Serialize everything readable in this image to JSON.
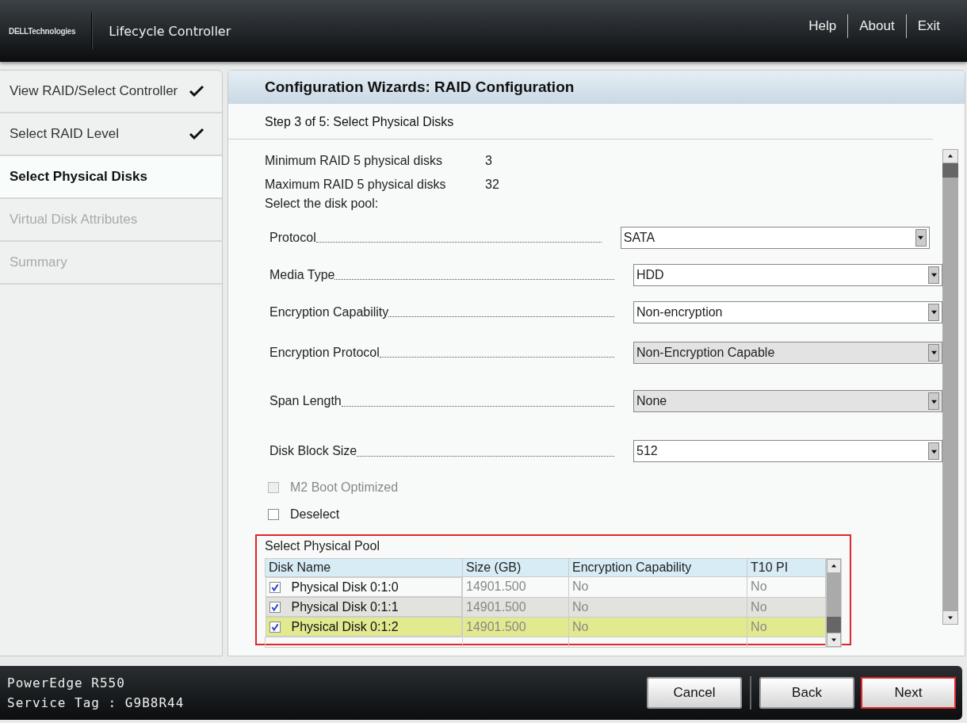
{
  "header": {
    "brand": "DELLTechnologies",
    "title": "Lifecycle Controller",
    "links": [
      "Help",
      "About",
      "Exit"
    ]
  },
  "steps": [
    {
      "label": "View RAID/Select Controller",
      "done": true,
      "selected": false,
      "disabled": false
    },
    {
      "label": "Select RAID Level",
      "done": true,
      "selected": false,
      "disabled": false
    },
    {
      "label": "Select Physical Disks",
      "done": false,
      "selected": true,
      "disabled": false
    },
    {
      "label": "Virtual Disk Attributes",
      "done": false,
      "selected": false,
      "disabled": true
    },
    {
      "label": "Summary",
      "done": false,
      "selected": false,
      "disabled": true
    }
  ],
  "panel": {
    "title": "Configuration Wizards: RAID Configuration",
    "step": "Step 3 of 5: Select Physical Disks",
    "info": [
      {
        "label": "Minimum RAID 5 physical disks",
        "value": "3"
      },
      {
        "label": "Maximum RAID 5 physical disks",
        "value": "32"
      }
    ],
    "pool_prompt": "Select the disk pool:",
    "fields": [
      {
        "label": "Protocol",
        "value": "SATA",
        "disabled": false
      },
      {
        "label": "Media Type",
        "value": "HDD",
        "disabled": false
      },
      {
        "label": "Encryption Capability",
        "value": "Non-encryption",
        "disabled": false
      },
      {
        "label": "Encryption Protocol",
        "value": "Non-Encryption Capable",
        "disabled": true
      },
      {
        "label": "Span Length",
        "value": "None",
        "disabled": true
      },
      {
        "label": "Disk Block Size",
        "value": "512",
        "disabled": false
      }
    ],
    "checkboxes": [
      {
        "label": "M2 Boot Optimized",
        "checked": false,
        "disabled": true
      },
      {
        "label": "Deselect",
        "checked": false,
        "disabled": false
      }
    ],
    "pool": {
      "title": "Select Physical Pool",
      "highlighted": true,
      "columns": [
        "Disk Name",
        "Size (GB)",
        "Encryption Capability",
        "T10 PI"
      ],
      "rows": [
        {
          "checked": true,
          "selected": false,
          "cells": [
            "Physical Disk 0:1:0",
            "14901.500",
            "No",
            "No"
          ]
        },
        {
          "checked": true,
          "selected": false,
          "cells": [
            "Physical Disk 0:1:1",
            "14901.500",
            "No",
            "No"
          ]
        },
        {
          "checked": true,
          "selected": true,
          "cells": [
            "Physical Disk 0:1:2",
            "14901.500",
            "No",
            "No"
          ]
        }
      ]
    }
  },
  "footer": {
    "model": "PowerEdge R550",
    "service_tag": "Service Tag : G9B8R44",
    "buttons": [
      {
        "label": "Cancel",
        "highlighted": false
      },
      {
        "label": "Back",
        "highlighted": false
      },
      {
        "label": "Next",
        "highlighted": true
      }
    ]
  }
}
